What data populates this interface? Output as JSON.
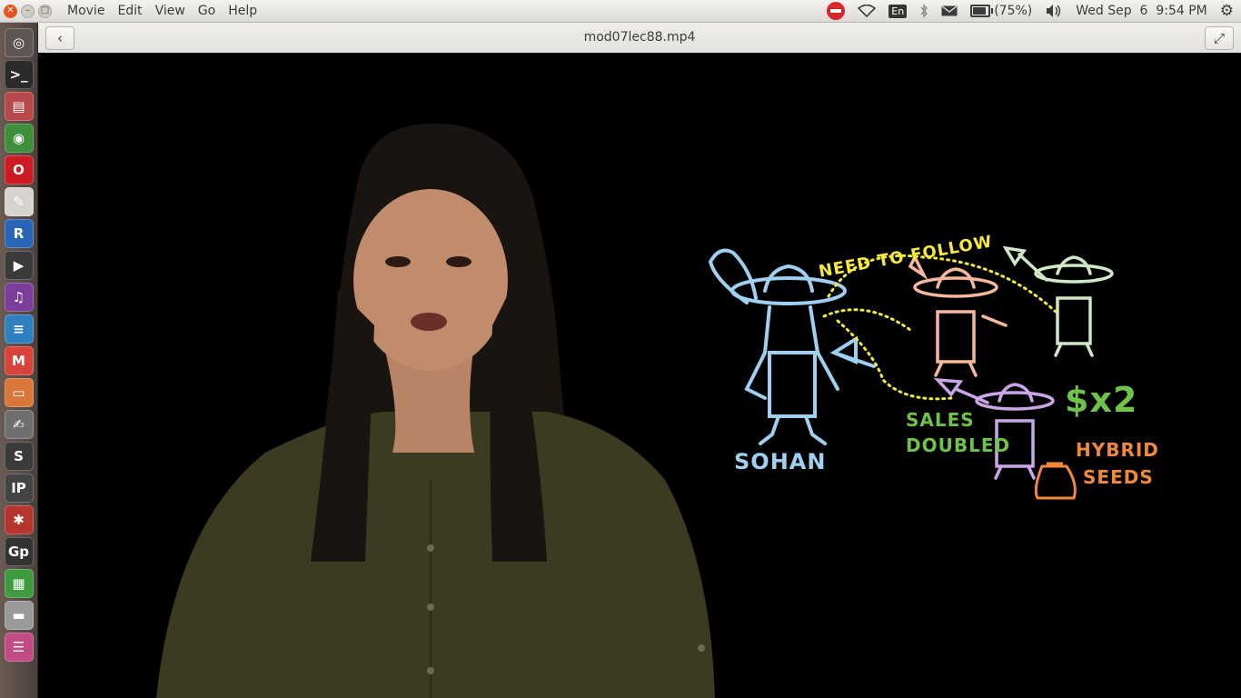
{
  "menubar": {
    "items": [
      "Movie",
      "Edit",
      "View",
      "Go",
      "Help"
    ],
    "battery_text": "(75%)",
    "battery_level": 0.75,
    "keyboard_layout": "En",
    "datetime": "Wed Sep  6  9:54 PM",
    "icons": [
      "no-entry-icon",
      "wifi-icon",
      "keyboard-icon",
      "bluetooth-icon",
      "mail-icon",
      "battery-icon",
      "volume-icon",
      "gear-icon"
    ]
  },
  "header": {
    "title": "mod07lec88.mp4",
    "back_icon": "chevron-left-icon",
    "fullscreen_icon": "fullscreen-icon"
  },
  "launcher": [
    {
      "name": "dash-icon",
      "glyph": "◎",
      "color": "#5d5654"
    },
    {
      "name": "terminal-icon",
      "glyph": ">_",
      "color": "#2b2b2b"
    },
    {
      "name": "archive-icon",
      "glyph": "▤",
      "color": "#b8484c"
    },
    {
      "name": "chrome-icon",
      "glyph": "◉",
      "color": "#3f8e3a"
    },
    {
      "name": "opera-icon",
      "glyph": "O",
      "color": "#cc1b22"
    },
    {
      "name": "document-viewer-icon",
      "glyph": "✎",
      "color": "#d7d4cf"
    },
    {
      "name": "r-icon",
      "glyph": "R",
      "color": "#2a66b5"
    },
    {
      "name": "video-icon",
      "glyph": "▶",
      "color": "#3a3a3a"
    },
    {
      "name": "media-icon",
      "glyph": "♫",
      "color": "#7b3f9b"
    },
    {
      "name": "writer-icon",
      "glyph": "≡",
      "color": "#2f7fc1"
    },
    {
      "name": "gmail-icon",
      "glyph": "M",
      "color": "#d8433a"
    },
    {
      "name": "impress-icon",
      "glyph": "▭",
      "color": "#d9773b"
    },
    {
      "name": "text-editor-icon",
      "glyph": "✍",
      "color": "#6f6f6f"
    },
    {
      "name": "sublime-icon",
      "glyph": "S",
      "color": "#3b3b3b"
    },
    {
      "name": "ipython-icon",
      "glyph": "IP",
      "color": "#444"
    },
    {
      "name": "settings-icon",
      "glyph": "✱",
      "color": "#b6352f"
    },
    {
      "name": "gp-icon",
      "glyph": "Gp",
      "color": "#333"
    },
    {
      "name": "calc-icon",
      "glyph": "▦",
      "color": "#3f9b3f"
    },
    {
      "name": "drive-icon",
      "glyph": "▬",
      "color": "#9a9a9a"
    },
    {
      "name": "stacked-icon",
      "glyph": "☰",
      "color": "#c24b86"
    }
  ],
  "video": {
    "labels": {
      "need_to_follow": "NEED TO FOLLOW",
      "sohan": "SOHAN",
      "sales_doubled_1": "SALES",
      "sales_doubled_2": "DOUBLED",
      "price": "$x2",
      "hybrid": "HYBRID",
      "seeds": "SEEDS"
    },
    "colors": {
      "blue": "#9fd0f0",
      "yellow": "#f6ea3a",
      "peach": "#f7b89d",
      "mint": "#cfe9c7",
      "lilac": "#c9a6e6",
      "green": "#6fc24a",
      "orange": "#f08a3a",
      "shirt": "#3a3a22"
    }
  }
}
